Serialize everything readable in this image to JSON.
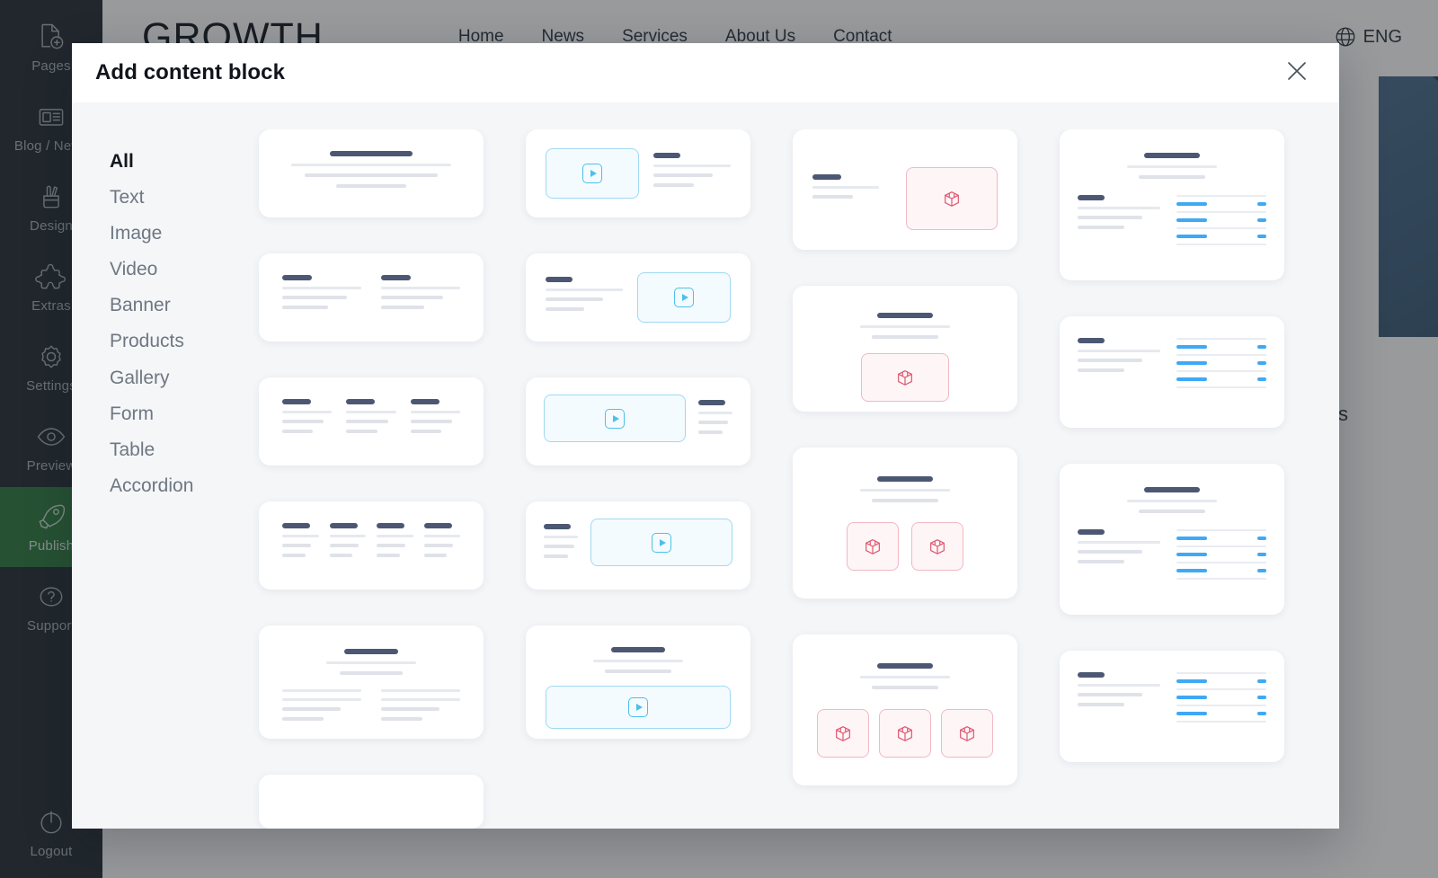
{
  "sidebar": {
    "items": [
      {
        "label": "Pages",
        "icon": "page-plus-icon",
        "active": false
      },
      {
        "label": "Blog / News",
        "icon": "newspaper-icon",
        "active": false
      },
      {
        "label": "Design",
        "icon": "design-tools-icon",
        "active": false
      },
      {
        "label": "Extras",
        "icon": "puzzle-icon",
        "active": false
      },
      {
        "label": "Settings",
        "icon": "gear-icon",
        "active": false
      },
      {
        "label": "Preview",
        "icon": "eye-icon",
        "active": false
      },
      {
        "label": "Publish",
        "icon": "rocket-icon",
        "active": true
      },
      {
        "label": "Support",
        "icon": "question-icon",
        "active": false
      }
    ],
    "logout": {
      "label": "Logout",
      "icon": "power-icon"
    },
    "active_color": "#2d7a3e",
    "background": "#242b33"
  },
  "site": {
    "brand": "GROWTH",
    "nav": [
      "Home",
      "News",
      "Services",
      "About Us",
      "Contact"
    ],
    "language": "ENG",
    "language_icon": "globe-icon",
    "stray_text": "s"
  },
  "modal": {
    "title": "Add content block",
    "close_icon": "close-icon",
    "categories": [
      {
        "label": "All",
        "active": true
      },
      {
        "label": "Text",
        "active": false
      },
      {
        "label": "Image",
        "active": false
      },
      {
        "label": "Video",
        "active": false
      },
      {
        "label": "Banner",
        "active": false
      },
      {
        "label": "Products",
        "active": false
      },
      {
        "label": "Gallery",
        "active": false
      },
      {
        "label": "Form",
        "active": false
      },
      {
        "label": "Table",
        "active": false
      },
      {
        "label": "Accordion",
        "active": false
      }
    ],
    "columns": [
      {
        "name": "text-blocks",
        "tiles": [
          {
            "name": "text-centered-heading-paragraph",
            "type": "text-center"
          },
          {
            "name": "text-two-column",
            "type": "text-cols",
            "cols": 2
          },
          {
            "name": "text-three-column",
            "type": "text-cols",
            "cols": 3
          },
          {
            "name": "text-four-column",
            "type": "text-cols",
            "cols": 4
          },
          {
            "name": "text-heading-with-two-columns",
            "type": "text-head-cols"
          },
          {
            "name": "text-block-partial",
            "type": "partial"
          }
        ]
      },
      {
        "name": "video-blocks",
        "tiles": [
          {
            "name": "video-left-text-right",
            "type": "video-left"
          },
          {
            "name": "video-right-text-left",
            "type": "video-right"
          },
          {
            "name": "video-wide-text-right",
            "type": "video-wide-left"
          },
          {
            "name": "video-wide-text-left",
            "type": "video-wide-right"
          },
          {
            "name": "video-below-heading",
            "type": "video-center"
          }
        ]
      },
      {
        "name": "product-blocks",
        "tiles": [
          {
            "name": "product-single-right",
            "type": "product-right"
          },
          {
            "name": "product-single-centered",
            "type": "product-center",
            "count": 1
          },
          {
            "name": "product-two-up",
            "type": "product-center",
            "count": 2
          },
          {
            "name": "product-three-up",
            "type": "product-center",
            "count": 3
          }
        ]
      },
      {
        "name": "table-blocks",
        "tiles": [
          {
            "name": "table-with-heading",
            "type": "table-head"
          },
          {
            "name": "table-plain",
            "type": "table-plain"
          },
          {
            "name": "table-with-heading-alt",
            "type": "table-head"
          },
          {
            "name": "table-plain-alt",
            "type": "table-plain"
          }
        ]
      }
    ]
  },
  "colors": {
    "accent_blue": "#3fa9f5",
    "video_outline": "#9fd9f2",
    "product_outline": "#f0b9c3",
    "heading_bar": "#4c5873",
    "publish_green": "#2d7a3e",
    "modal_bg": "#f4f6f8"
  }
}
